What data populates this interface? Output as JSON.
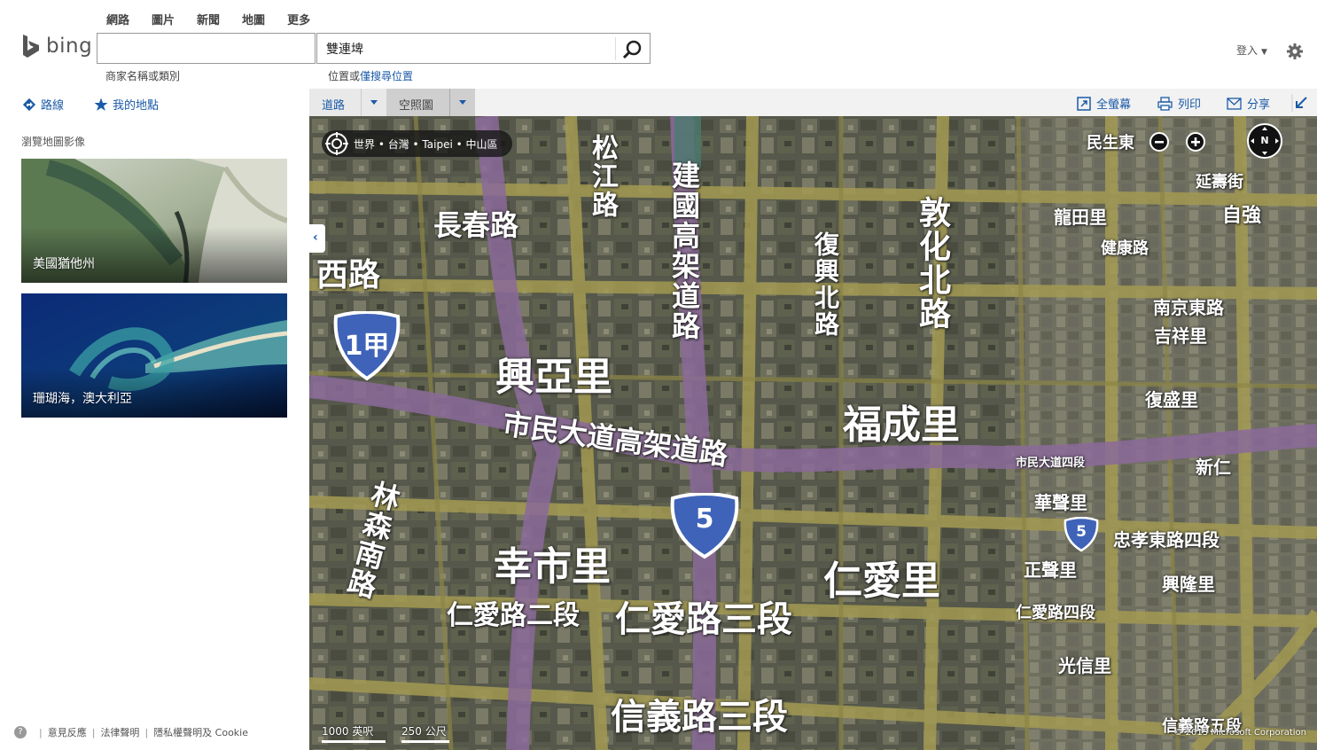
{
  "topnav": [
    "網路",
    "圖片",
    "新聞",
    "地圖",
    "更多"
  ],
  "logo": {
    "word": "bing"
  },
  "search": {
    "what_value": "",
    "where_value": "雙連埤",
    "what_hint": "商家名稱或類別",
    "where_hint_prefix": "位置或",
    "where_hint_link": "僅搜尋位置"
  },
  "account": {
    "signin": "登入"
  },
  "leftbar": {
    "directions": "路線",
    "my_places": "我的地點"
  },
  "leftpanel": {
    "browse_title": "瀏覽地圖影像",
    "thumbs": [
      {
        "label": "美國猶他州"
      },
      {
        "label": "珊瑚海，澳大利亞"
      }
    ]
  },
  "footer": {
    "feedback": "意見反應",
    "legal": "法律聲明",
    "privacy": "隱私權聲明及 Cookie",
    "sep": "|",
    "help": "?"
  },
  "maptoolbar": {
    "road": "道路",
    "aerial": "空照圖",
    "fullscreen": "全螢幕",
    "print": "列印",
    "share": "分享"
  },
  "map": {
    "breadcrumb": "世界 • 台灣 • Taipei • 中山區",
    "compass": "N",
    "scale_miles": "1000 英呎",
    "scale_meters": "250 公尺",
    "copyright": "© 2015 Microsoft Corporation",
    "labels": {
      "changchun": "長春路",
      "xinyali": "興亞里",
      "fuchengli": "福成里",
      "xinshili": "幸市里",
      "renaili": "仁愛里",
      "renai2": "仁愛路二段",
      "renai3": "仁愛路三段",
      "xinyi3": "信義路三段",
      "civic": "市民大道高架道路",
      "xilu": "西路",
      "songjiang": "松江路",
      "jianguo": "建國高架道路",
      "fuxing": "復興北路",
      "dunhua": "敦化北路",
      "linsen": "林森南路",
      "minsheng": "民生東",
      "longtianli": "龍田里",
      "yanshou": "延壽街",
      "zijiang": "自強",
      "jiankang": "健康路",
      "nanjing": "南京東路",
      "jixiangli": "吉祥里",
      "fushengli": "復盛里",
      "civic4": "市民大道四段",
      "huashengli": "華聲里",
      "zhongxiao": "忠孝東路四段",
      "zhengshengli": "正聲里",
      "xinglongli": "興隆里",
      "renai4": "仁愛路四段",
      "guangxinli": "光信里",
      "xinyi5": "信義路五段",
      "xinren": "新仁",
      "shield_1a": "1甲",
      "shield_5": "5",
      "shield_5b": "5"
    }
  }
}
